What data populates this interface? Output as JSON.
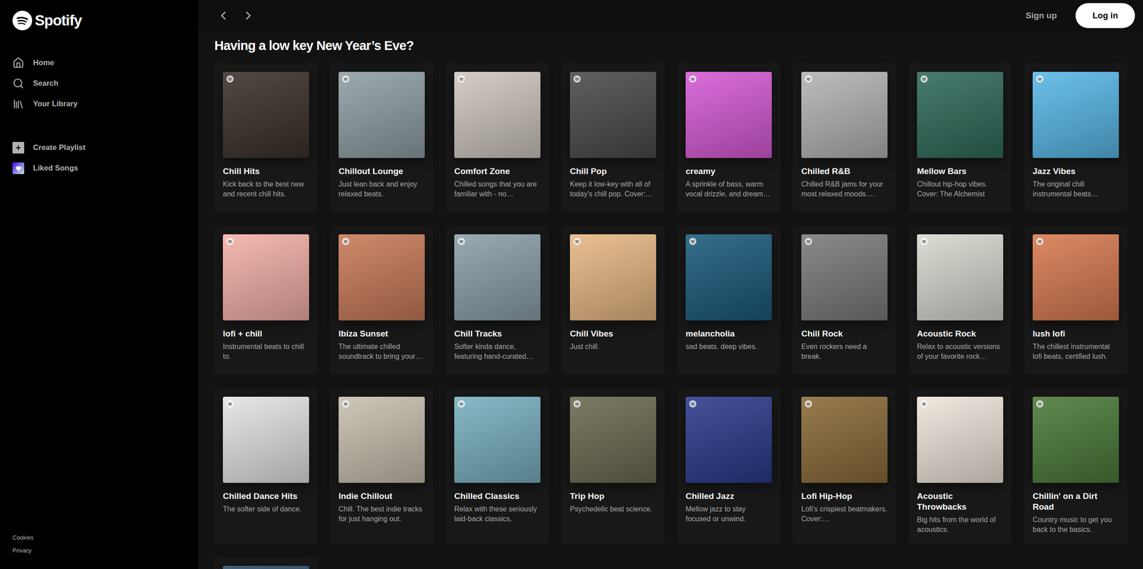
{
  "logo": {
    "text": "Spotify"
  },
  "sidebar": {
    "nav": [
      {
        "label": "Home",
        "icon": "home",
        "selected": false
      },
      {
        "label": "Search",
        "icon": "search",
        "selected": false
      },
      {
        "label": "Your Library",
        "icon": "library",
        "selected": false
      }
    ],
    "library_actions": [
      {
        "label": "Create Playlist",
        "icon": "plus"
      },
      {
        "label": "Liked Songs",
        "icon": "heart"
      }
    ],
    "footer_links": [
      "Cookies",
      "Privacy"
    ]
  },
  "top_bar": {
    "sign_up": "Sign up",
    "log_in": "Log in"
  },
  "section": {
    "title": "Having a low key New Year’s Eve?",
    "cards": [
      {
        "title": "Chill Hits",
        "description": "Kick back to the best new and recent chill hits.",
        "color": "#3a302a"
      },
      {
        "title": "Chillout Lounge",
        "description": "Just lean back and enjoy relaxed beats.",
        "color": "#8f9fa4"
      },
      {
        "title": "Comfort Zone",
        "description": "Chilled songs that you are familiar with - no…",
        "color": "#cfc7bf"
      },
      {
        "title": "Chill Pop",
        "description": "Keep it low-key with all of today's chill pop. Cover:…",
        "color": "#4a4a4a"
      },
      {
        "title": "creamy",
        "description": "A sprinkle of bass, warm vocal drizzle, and dream…",
        "color": "#d65ad6"
      },
      {
        "title": "Chilled R&B",
        "description": "Chilled R&B jams for your most relaxed moods.…",
        "color": "#b4b4b4"
      },
      {
        "title": "Mellow Bars",
        "description": "Chillout hip-hop vibes. Cover: The Alchemist",
        "color": "#2f6a5a"
      },
      {
        "title": "Jazz Vibes",
        "description": "The original chill instrumental beats…",
        "color": "#58b8e8"
      },
      {
        "title": "lofi + chill",
        "description": "Instrumental beats to chill to.",
        "color": "#f4b0a8"
      },
      {
        "title": "Ibiza Sunset",
        "description": "The ultimate chilled soundtrack to bring your…",
        "color": "#c87a58"
      },
      {
        "title": "Chill Tracks",
        "description": "Softer kinda dance, featuring hand-curated…",
        "color": "#8aa0a8"
      },
      {
        "title": "Chill Vibes",
        "description": "Just chill.",
        "color": "#e8b884"
      },
      {
        "title": "melancholia",
        "description": "sad beats. deep vibes.",
        "color": "#1a5a7a"
      },
      {
        "title": "Chill Rock",
        "description": "Even rockers need a break.",
        "color": "#7a7a7a"
      },
      {
        "title": "Acoustic Rock",
        "description": "Relax to acoustic versions of your favorite rock…",
        "color": "#d8d8d0"
      },
      {
        "title": "lush lofi",
        "description": "The chillest instrumental lofi beats, certified lush.",
        "color": "#d87a50"
      },
      {
        "title": "Chilled Dance Hits",
        "description": "The softer side of dance.",
        "color": "#e4e4e4"
      },
      {
        "title": "Indie Chillout",
        "description": "Chill. The best indie tracks for just hanging out.",
        "color": "#c8c0b0"
      },
      {
        "title": "Chilled Classics",
        "description": "Relax with these seriously laid-back classics.",
        "color": "#78b0c0"
      },
      {
        "title": "Trip Hop",
        "description": "Psychedelic beat science.",
        "color": "#6a6a50"
      },
      {
        "title": "Chilled Jazz",
        "description": "Mellow jazz to stay focused or unwind.",
        "color": "#2a3a8a"
      },
      {
        "title": "Lofi Hip-Hop",
        "description": "Lofi's crispiest beatmakers. Cover:…",
        "color": "#8a6a38"
      },
      {
        "title": "Acoustic Throwbacks",
        "description": "Big hits from the world of acoustics.",
        "color": "#efe6dc"
      },
      {
        "title": "Chillin' on a Dirt Road",
        "description": "Country music to get you back to the basics.",
        "color": "#4a7a38"
      },
      {
        "title": "",
        "description": "",
        "color": "#2a4a6a"
      }
    ]
  }
}
